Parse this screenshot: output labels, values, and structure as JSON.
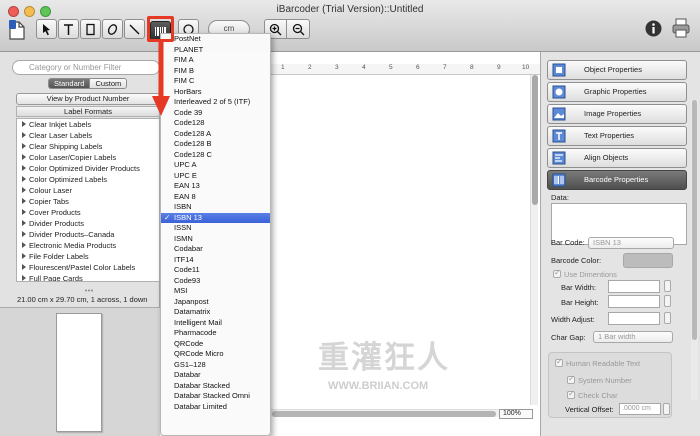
{
  "window": {
    "title": "iBarcoder (Trial Version)::Untitled"
  },
  "toolbar": {
    "units_label": "cm"
  },
  "left_panel": {
    "search_placeholder": "Category or Number Filter",
    "tabs": [
      {
        "label": "Standard"
      },
      {
        "label": "Custom"
      }
    ],
    "view_by_label": "View by Product Number",
    "label_formats_header": "Label Formats",
    "label_formats": [
      "Clear Inkjet Labels",
      "Clear Laser Labels",
      "Clear Shipping Labels",
      "Color Laser/Copier Labels",
      "Color Optimized Divider Products",
      "Color Optimized Labels",
      "Colour Laser",
      "Copier Tabs",
      "Cover Products",
      "Divider Products",
      "Divider Products–Canada",
      "Electronic Media Products",
      "File Folder Labels",
      "Flourescent/Pastel Color Labels",
      "Full Page Cards"
    ],
    "dimensions_text": "21.00 cm x 29.70 cm, 1 across, 1 down"
  },
  "ruler": {
    "numbers": [
      "1",
      "2",
      "3",
      "4",
      "5",
      "6",
      "7",
      "8",
      "9",
      "10"
    ]
  },
  "barcode_menu": {
    "items": [
      "PostNet",
      "PLANET",
      "FIM A",
      "FIM B",
      "FIM C",
      "HorBars",
      "Interleaved 2 of 5 (ITF)",
      "Code 39",
      "Code128",
      "Code128 A",
      "Code128 B",
      "Code128 C",
      "UPC A",
      "UPC E",
      "EAN 13",
      "EAN 8",
      "ISBN",
      "ISBN 13",
      "ISSN",
      "ISMN",
      "Codabar",
      "ITF14",
      "Code11",
      "Code93",
      "MSI",
      "Japanpost",
      "Datamatrix",
      "Intelligent Mail",
      "Pharmacode",
      "QRCode",
      "QRCode Micro",
      "GS1–128",
      "Databar",
      "Databar Stacked",
      "Databar Stacked Omni",
      "Databar Limited"
    ],
    "selected": "ISBN 13",
    "check_mark": "✓"
  },
  "canvas": {
    "zoom": "100%"
  },
  "right_panel": {
    "buttons": [
      {
        "label": "Object Properties",
        "icon": "object-properties-icon"
      },
      {
        "label": "Graphic Properties",
        "icon": "graphic-properties-icon"
      },
      {
        "label": "Image Properties",
        "icon": "image-properties-icon"
      },
      {
        "label": "Text Properties",
        "icon": "text-properties-icon"
      },
      {
        "label": "Align Objects",
        "icon": "align-objects-icon"
      },
      {
        "label": "Barcode Properties",
        "icon": "barcode-properties-icon"
      }
    ],
    "data_label": "Data:",
    "bar_code_label": "Bar Code:",
    "bar_code_value": "ISBN 13",
    "barcode_color_label": "Barcode Color:",
    "use_dimentions_label": "Use Dimentions",
    "bar_width_label": "Bar Width:",
    "bar_height_label": "Bar Height:",
    "width_adjust_label": "Width Adjust:",
    "char_gap_label": "Char Gap:",
    "char_gap_value": "1 Bar width",
    "human_readable_label": "Human Readable Text",
    "system_number_label": "System Number",
    "check_char_label": "Check Char",
    "vertical_offset_label": "Vertical Offset:",
    "vertical_offset_value": ".0000 cm"
  },
  "watermark": {
    "big": "重灌狂人",
    "small": "WWW.BRIIAN.COM"
  },
  "colors": {
    "highlight": "#e53825",
    "selection": "#3a62d8",
    "barcode_color_swatch": "#bcbcbc"
  }
}
